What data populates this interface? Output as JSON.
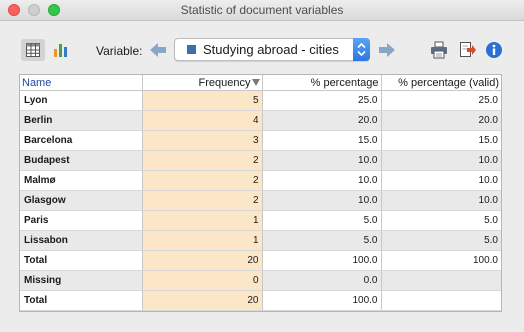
{
  "window": {
    "title": "Statistic of document variables"
  },
  "toolbar": {
    "variable_label": "Variable:",
    "selected_variable": "Studying abroad - cities"
  },
  "colors": {
    "frequency_column": "#fbe6c8",
    "shaded_row": "#e9e9e9",
    "header_name_text": "#1f4aa8",
    "info_icon": "#2a6fd4",
    "nav_arrow": "#8aa6c6"
  },
  "icons": [
    "table-icon",
    "bar-chart-icon",
    "arrow-left-icon",
    "arrow-right-icon",
    "stepper-icon",
    "printer-icon",
    "export-icon",
    "info-icon",
    "sort-down-icon"
  ],
  "table": {
    "headers": [
      "Name",
      "Frequency",
      "% percentage",
      "% percentage (valid)"
    ],
    "rows": [
      {
        "name": "Lyon",
        "freq": "5",
        "pct": "25.0",
        "pct_valid": "25.0"
      },
      {
        "name": "Berlin",
        "freq": "4",
        "pct": "20.0",
        "pct_valid": "20.0"
      },
      {
        "name": "Barcelona",
        "freq": "3",
        "pct": "15.0",
        "pct_valid": "15.0"
      },
      {
        "name": "Budapest",
        "freq": "2",
        "pct": "10.0",
        "pct_valid": "10.0"
      },
      {
        "name": "Malmø",
        "freq": "2",
        "pct": "10.0",
        "pct_valid": "10.0"
      },
      {
        "name": "Glasgow",
        "freq": "2",
        "pct": "10.0",
        "pct_valid": "10.0"
      },
      {
        "name": "Paris",
        "freq": "1",
        "pct": "5.0",
        "pct_valid": "5.0"
      },
      {
        "name": "Lissabon",
        "freq": "1",
        "pct": "5.0",
        "pct_valid": "5.0"
      },
      {
        "name": "Total",
        "freq": "20",
        "pct": "100.0",
        "pct_valid": "100.0"
      },
      {
        "name": "Missing",
        "freq": "0",
        "pct": "0.0",
        "pct_valid": ""
      },
      {
        "name": "Total",
        "freq": "20",
        "pct": "100.0",
        "pct_valid": ""
      }
    ]
  }
}
